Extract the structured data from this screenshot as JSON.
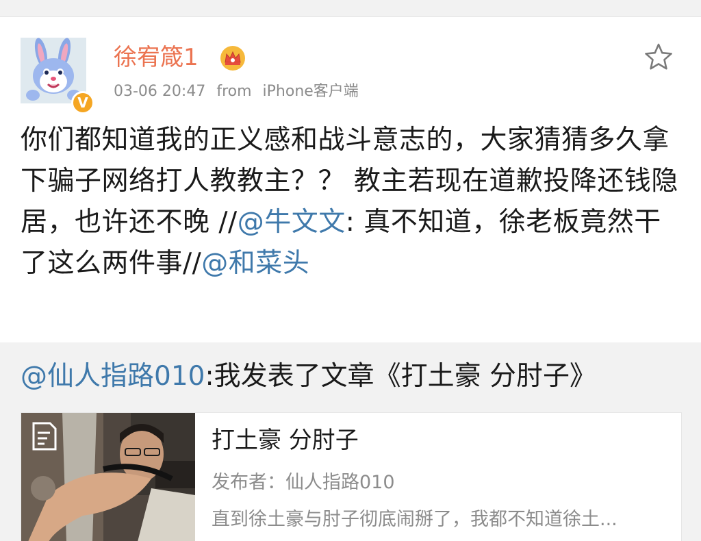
{
  "post": {
    "username": "徐宥箴1",
    "timestamp": "03-06 20:47",
    "source_prefix": "from",
    "source": "iPhone客户端",
    "verify_mark": "V",
    "body_prefix": "你们都知道我的正义感和战斗意志的，大家猜猜多久拿下骗子网络打人教教主？？ 教主若现在道歉投降还钱隐居，也许还不晚 //",
    "mention_1": "@牛文文",
    "body_middle": ": 真不知道，徐老板竟然干了这么两件事//",
    "mention_2": "@和菜头"
  },
  "repost": {
    "author_mention": "@仙人指路010",
    "text": ":我发表了文章《打土豪 分肘子》",
    "article": {
      "title": "打土豪 分肘子",
      "author_line": "发布者：仙人指路010",
      "summary": "直到徐土豪与肘子彻底闹掰了，我都不知道徐土..."
    }
  },
  "colors": {
    "username": "#eb7350",
    "mention": "#3f79ab",
    "meta": "#8c8c8c",
    "repost_bg": "#f2f2f2",
    "badge": "#f5a623"
  },
  "icons": [
    "crown-icon",
    "star-icon",
    "verified-icon",
    "article-icon"
  ]
}
